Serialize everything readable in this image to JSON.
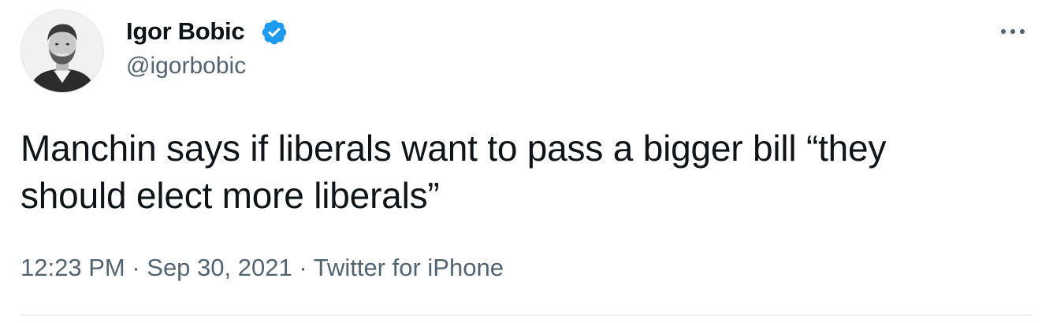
{
  "author": {
    "display_name": "Igor Bobic",
    "handle": "@igorbobic",
    "verified": true
  },
  "tweet": {
    "text_line1": "Manchin says if liberals want to pass a bigger bill “they",
    "text_line2": "should elect more liberals”"
  },
  "meta": {
    "time": "12:23 PM",
    "separator": " · ",
    "date": "Sep 30, 2021",
    "separator2": " · ",
    "source": "Twitter for iPhone"
  },
  "icons": {
    "verified": "verified-badge-icon",
    "more": "more-options-icon"
  },
  "colors": {
    "verified_blue": "#1d9bf0",
    "text_primary": "#0f1419",
    "text_secondary": "#536471",
    "divider": "#eff3f4"
  }
}
